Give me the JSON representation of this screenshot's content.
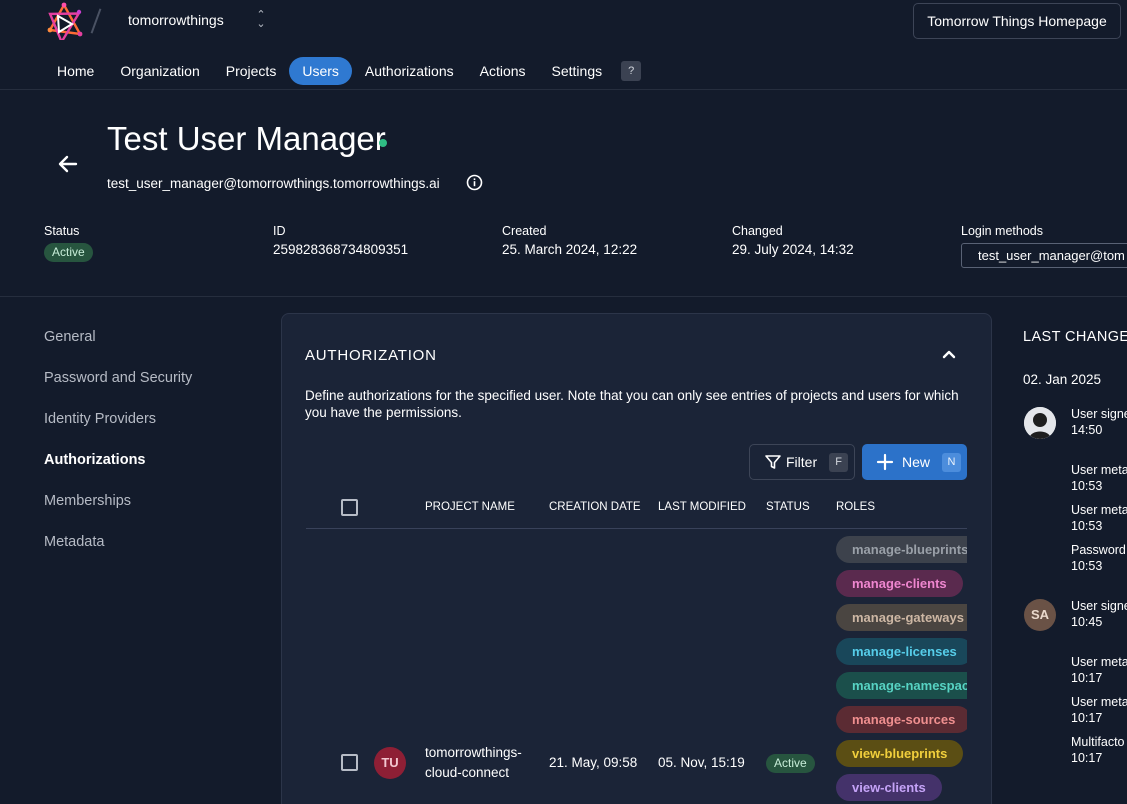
{
  "topbar": {
    "org_name": "tomorrowthings",
    "homepage_button": "Tomorrow Things Homepage"
  },
  "nav": {
    "tabs": [
      {
        "label": "Home"
      },
      {
        "label": "Organization"
      },
      {
        "label": "Projects"
      },
      {
        "label": "Users"
      },
      {
        "label": "Authorizations"
      },
      {
        "label": "Actions"
      },
      {
        "label": "Settings"
      }
    ],
    "active_tab": "Users",
    "help_label": "?"
  },
  "user": {
    "name": "Test User Manager",
    "email": "test_user_manager@tomorrowthings.tomorrowthings.ai",
    "status_label": "Status",
    "status_value": "Active",
    "id_label": "ID",
    "id_value": "259828368734809351",
    "created_label": "Created",
    "created_value": "25. March 2024, 12:22",
    "changed_label": "Changed",
    "changed_value": "29. July 2024, 14:32",
    "login_label": "Login methods",
    "login_value": "test_user_manager@tom"
  },
  "sidebar": {
    "items": [
      {
        "label": "General"
      },
      {
        "label": "Password and Security"
      },
      {
        "label": "Identity Providers"
      },
      {
        "label": "Authorizations"
      },
      {
        "label": "Memberships"
      },
      {
        "label": "Metadata"
      }
    ],
    "active": "Authorizations"
  },
  "authorization": {
    "title": "AUTHORIZATION",
    "description": "Define authorizations for the specified user. Note that you can only see entries of projects and users for which you have the permissions.",
    "filter_label": "Filter",
    "filter_key": "F",
    "new_label": "New",
    "new_key": "N",
    "columns": [
      "PROJECT NAME",
      "CREATION DATE",
      "LAST MODIFIED",
      "STATUS",
      "ROLES"
    ],
    "rows": [
      {
        "avatar": "TU",
        "project_line1": "tomorrowthings-",
        "project_line2": "cloud-connect",
        "creation_date": "21. May, 09:58",
        "last_modified": "05. Nov, 15:19",
        "status": "Active",
        "roles": [
          {
            "label": "manage-blueprints",
            "color": "#9aa0a8",
            "bg": "#3d424c"
          },
          {
            "label": "manage-clients",
            "color": "#ee86cf",
            "bg": "#5a2a4e"
          },
          {
            "label": "manage-gateways",
            "color": "#cdb7a4",
            "bg": "#4a4541"
          },
          {
            "label": "manage-licenses",
            "color": "#56cde9",
            "bg": "#19475a"
          },
          {
            "label": "manage-namespaces",
            "color": "#57d3c3",
            "bg": "#1b4f4b"
          },
          {
            "label": "manage-sources",
            "color": "#ef8f8f",
            "bg": "#5b2b33"
          },
          {
            "label": "view-blueprints",
            "color": "#f1cf3c",
            "bg": "#5b4e14"
          },
          {
            "label": "view-clients",
            "color": "#c5a3f7",
            "bg": "#44326a"
          }
        ]
      }
    ]
  },
  "last_changes": {
    "title": "LAST CHANGES",
    "date": "02. Jan 2025",
    "events": [
      {
        "line1": "User signed",
        "line2": "14:50"
      },
      {
        "line1": "User metad",
        "line2": "10:53"
      },
      {
        "line1": "User metad",
        "line2": "10:53"
      },
      {
        "line1": "Password",
        "line2": "10:53"
      },
      {
        "line1": "User signed",
        "line2": "10:45"
      },
      {
        "line1": "User metad",
        "line2": "10:17"
      },
      {
        "line1": "User metad",
        "line2": "10:17"
      },
      {
        "line1": "Multifacto",
        "line2": "10:17"
      }
    ],
    "second_avatar": "SA"
  },
  "colors": {
    "background": "#131b2b",
    "panel": "#1b2437",
    "accent": "#2f79d1",
    "online": "#2fbd84"
  }
}
